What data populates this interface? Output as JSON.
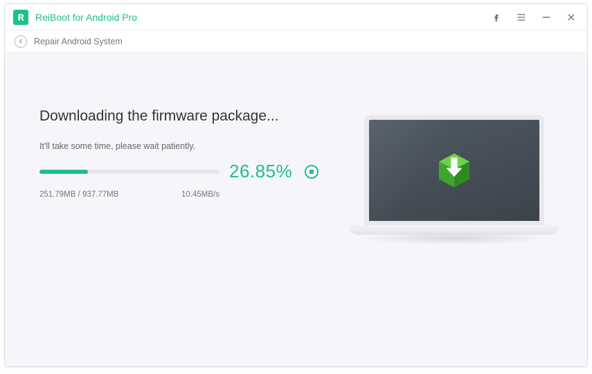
{
  "app": {
    "title": "ReiBoot for Android Pro"
  },
  "breadcrumb": {
    "label": "Repair Android System"
  },
  "download": {
    "heading": "Downloading the firmware package...",
    "subtext": "It'll take some time, please wait patiently.",
    "percent_text": "26.85%",
    "percent_value": 26.85,
    "progress_label": "251.79MB / 937.77MB",
    "speed": "10.45MB/s"
  },
  "colors": {
    "accent": "#1ec08a"
  }
}
